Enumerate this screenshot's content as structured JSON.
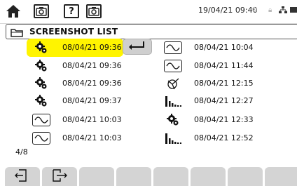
{
  "statusbar": {
    "datetime": "19/04/21 09:40",
    "icons": [
      "home-icon",
      "camera-icon",
      "help-icon",
      "camera-icon",
      "settings-icon",
      "lock-icon",
      "network-icon",
      "battery-icon"
    ]
  },
  "header": {
    "title": "SCREENSHOT LIST",
    "icon": "folder-icon"
  },
  "list": {
    "left": [
      {
        "icon": "settings-icon",
        "label": "08/04/21  09:36",
        "selected": true
      },
      {
        "icon": "settings-icon",
        "label": "08/04/21  09:36"
      },
      {
        "icon": "settings-icon",
        "label": "08/04/21  09:36"
      },
      {
        "icon": "settings-icon",
        "label": "08/04/21  09:37"
      },
      {
        "icon": "waveform-icon",
        "label": "08/04/21  10:03"
      },
      {
        "icon": "waveform-icon",
        "label": "08/04/21  10:03"
      }
    ],
    "right": [
      {
        "icon": "waveform-icon",
        "label": "08/04/21  10:04"
      },
      {
        "icon": "waveform-icon",
        "label": "08/04/21  11:44"
      },
      {
        "icon": "phasor-icon",
        "label": "08/04/21  12:15"
      },
      {
        "icon": "harmonics-icon",
        "label": "08/04/21  12:27"
      },
      {
        "icon": "settings-icon",
        "label": "08/04/21  12:33"
      },
      {
        "icon": "harmonics-icon",
        "label": "08/04/21  12:52"
      }
    ]
  },
  "pager": {
    "text": "4/8"
  },
  "softkeys": [
    "previous-page-icon",
    "next-page-icon",
    "",
    "",
    "",
    "",
    "",
    ""
  ],
  "colors": {
    "selection": "#fff400",
    "softkey": "#d4d4d4"
  }
}
